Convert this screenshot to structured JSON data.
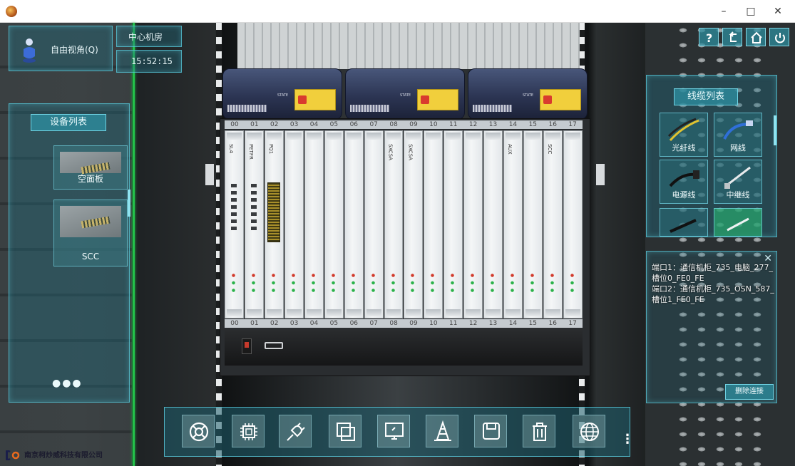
{
  "window": {
    "minimize": "–",
    "maximize": "□",
    "close": "✕"
  },
  "view": {
    "mode_label": "自由视角(Q)",
    "room_name": "中心机房",
    "clock": "15:52:15"
  },
  "device_list": {
    "title": "设备列表",
    "items": [
      {
        "label": "空面板"
      },
      {
        "label": "SCC"
      }
    ],
    "more": "●●●"
  },
  "rack": {
    "module_state": "STATE",
    "slot_numbers_top": [
      "00",
      "01",
      "02",
      "03",
      "04",
      "05",
      "06",
      "07",
      "08",
      "09",
      "10",
      "11",
      "12",
      "13",
      "14",
      "15",
      "16",
      "17"
    ],
    "slot_numbers_bottom": [
      "00",
      "01",
      "02",
      "03",
      "04",
      "05",
      "06",
      "07",
      "08",
      "09",
      "10",
      "11",
      "12",
      "13",
      "14",
      "15",
      "16",
      "17"
    ],
    "slots": [
      {
        "name": "SL4"
      },
      {
        "name": "PETFR"
      },
      {
        "name": "PQ1"
      },
      {
        "name": ""
      },
      {
        "name": ""
      },
      {
        "name": ""
      },
      {
        "name": ""
      },
      {
        "name": ""
      },
      {
        "name": "SXCSA"
      },
      {
        "name": "SXCSA"
      },
      {
        "name": ""
      },
      {
        "name": ""
      },
      {
        "name": ""
      },
      {
        "name": ""
      },
      {
        "name": "AUX"
      },
      {
        "name": ""
      },
      {
        "name": "SCC"
      },
      {
        "name": ""
      }
    ]
  },
  "cable_list": {
    "title": "线缆列表",
    "items": [
      {
        "label": "光纤线",
        "icon": "fiber-cable-icon"
      },
      {
        "label": "网线",
        "icon": "network-cable-icon"
      },
      {
        "label": "电源线",
        "icon": "power-cable-icon"
      },
      {
        "label": "中继线",
        "icon": "trunk-cable-icon"
      },
      {
        "label": "",
        "icon": "cable-icon"
      },
      {
        "label": "",
        "icon": "cable-icon"
      }
    ]
  },
  "connection": {
    "close": "✕",
    "text": "端口1：通信机柜_735_电脑_277_槽位0_FE0_FE\n端口2：通信机柜_735_OSN_587_槽位1_FE0_FE",
    "delete_label": "删除连接"
  },
  "toolbar": {
    "tools": [
      {
        "name": "rescue-ring-icon"
      },
      {
        "name": "chip-icon"
      },
      {
        "name": "plug-icon"
      },
      {
        "name": "panel-icon"
      },
      {
        "name": "monitor-icon"
      },
      {
        "name": "cone-icon"
      },
      {
        "name": "save-icon"
      },
      {
        "name": "trash-icon"
      },
      {
        "name": "globe-icon"
      }
    ],
    "more": "⋮"
  },
  "top_right_icons": [
    "help-icon",
    "back-icon",
    "home-icon",
    "power-icon"
  ],
  "colors": {
    "hud_border": "#5cd0e2",
    "hud_fill": "#206e80",
    "green_line": "#24c24a",
    "warn_label": "#f1cf3c"
  },
  "company_logo_text": "南京柯炒威科技有限公司"
}
